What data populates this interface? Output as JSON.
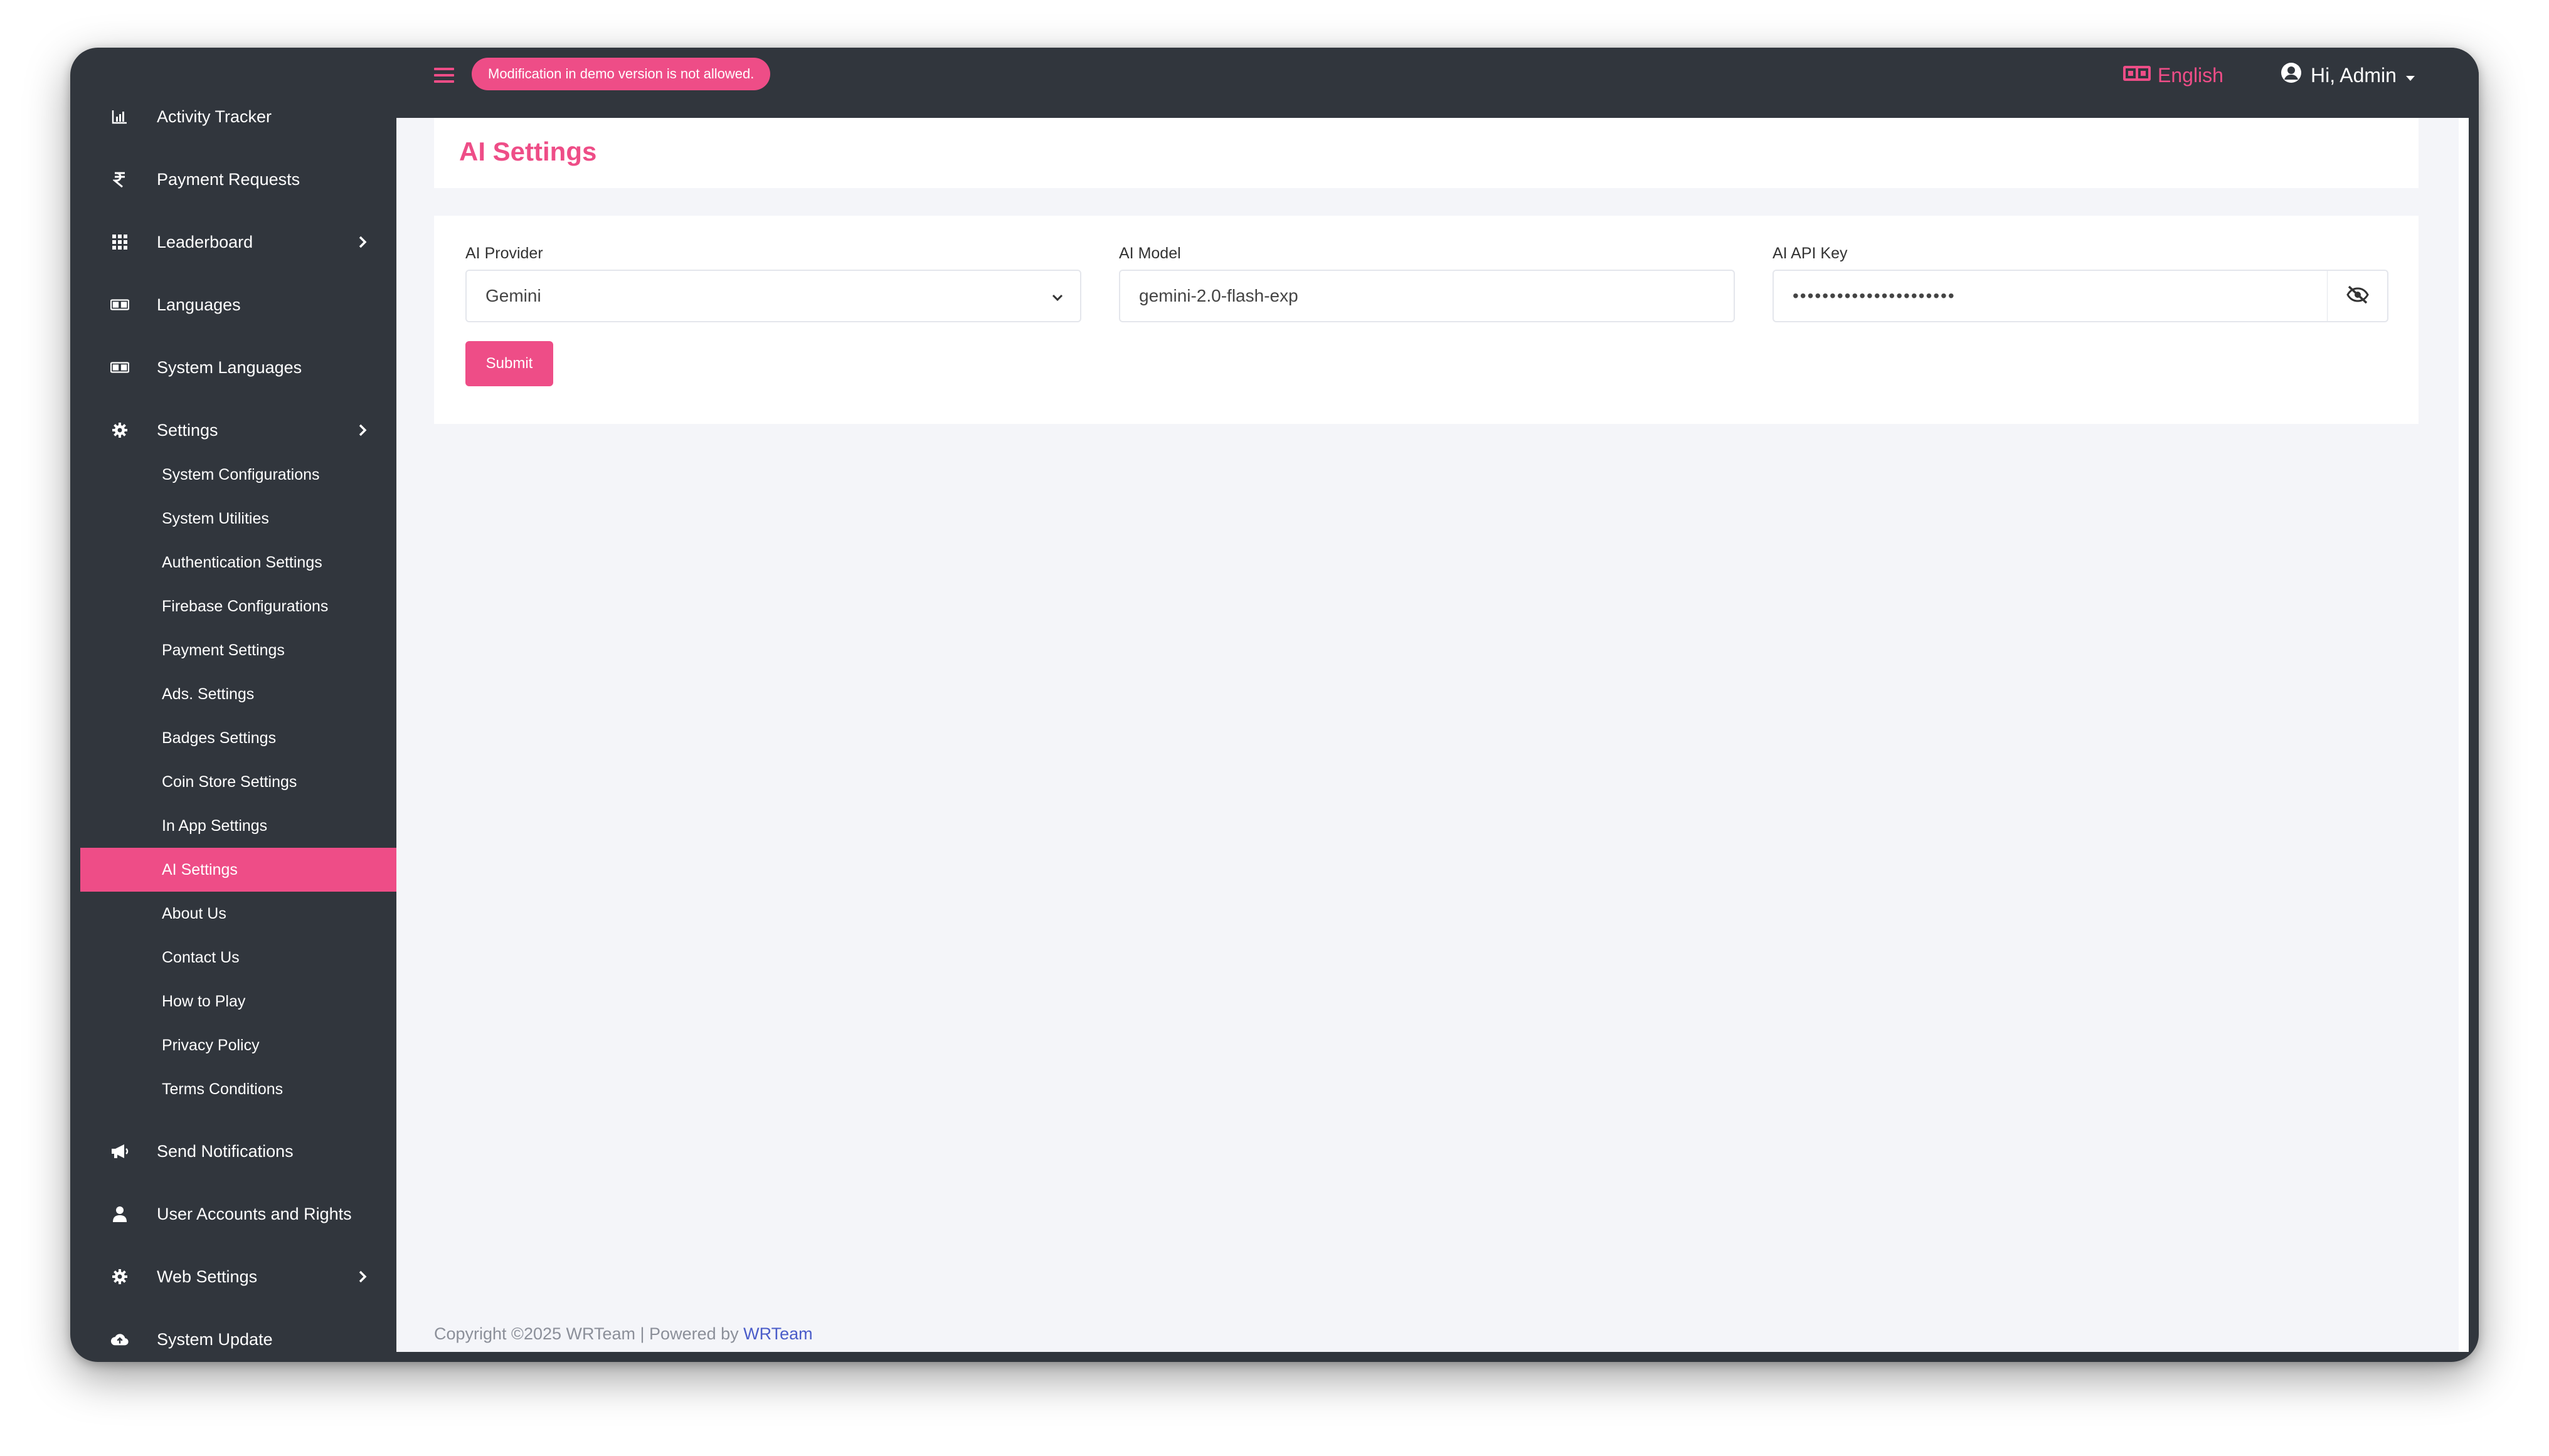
{
  "colors": {
    "accent": "#ee4d87",
    "sidebar_bg": "#31363d",
    "content_bg": "#f4f5f9",
    "link": "#4a5cc9"
  },
  "topbar": {
    "demo_notice": "Modification in demo version is not allowed.",
    "language": "English",
    "language_icon": "language-icon",
    "greeting": "Hi, Admin",
    "user_icon": "user-circle-icon"
  },
  "sidebar": {
    "items": [
      {
        "label": "Activity Tracker",
        "icon": "chart-icon"
      },
      {
        "label": "Payment Requests",
        "icon": "rupee-icon"
      },
      {
        "label": "Leaderboard",
        "icon": "grid-icon",
        "has_submenu": true
      },
      {
        "label": "Languages",
        "icon": "language-icon"
      },
      {
        "label": "System Languages",
        "icon": "language-icon"
      },
      {
        "label": "Settings",
        "icon": "gear-icon",
        "has_submenu": true,
        "expanded": true
      },
      {
        "label": "Send Notifications",
        "icon": "megaphone-icon"
      },
      {
        "label": "User Accounts and Rights",
        "icon": "user-icon"
      },
      {
        "label": "Web Settings",
        "icon": "gear-icon",
        "has_submenu": true
      },
      {
        "label": "System Update",
        "icon": "cloud-upload-icon"
      }
    ],
    "settings_submenu": [
      "System Configurations",
      "System Utilities",
      "Authentication Settings",
      "Firebase Configurations",
      "Payment Settings",
      "Ads. Settings",
      "Badges Settings",
      "Coin Store Settings",
      "In App Settings",
      "AI Settings",
      "About Us",
      "Contact Us",
      "How to Play",
      "Privacy Policy",
      "Terms Conditions"
    ],
    "active_submenu": "AI Settings"
  },
  "page": {
    "title": "AI Settings"
  },
  "form": {
    "provider": {
      "label": "AI Provider",
      "value": "Gemini"
    },
    "model": {
      "label": "AI Model",
      "value": "gemini-2.0-flash-exp"
    },
    "api_key": {
      "label": "AI API Key",
      "value": "••••••••••••••••••••••"
    },
    "submit_label": "Submit"
  },
  "footer": {
    "copyright": "Copyright ©2025 WRTeam | Powered by ",
    "link_text": "WRTeam"
  }
}
